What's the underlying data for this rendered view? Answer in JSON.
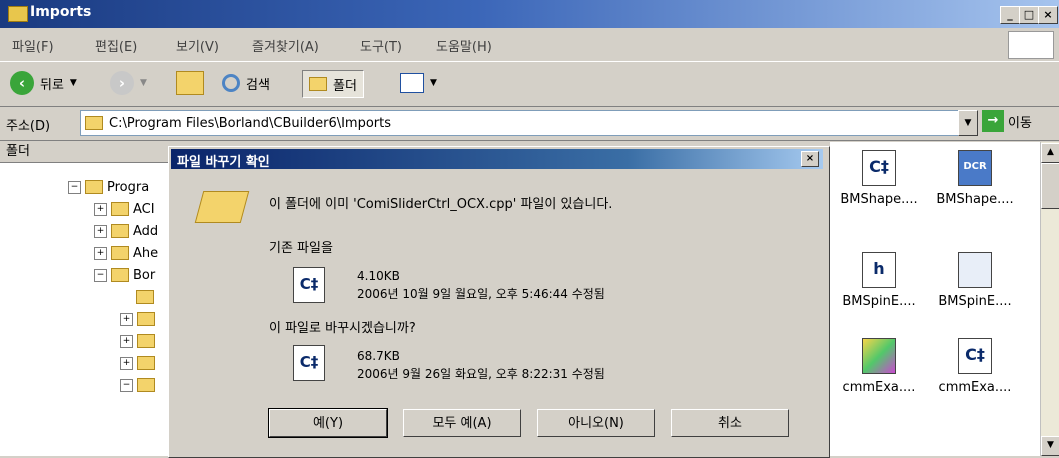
{
  "window": {
    "title": "Imports"
  },
  "menu": [
    "파일(F)",
    "편집(E)",
    "보기(V)",
    "즐겨찾기(A)",
    "도구(T)",
    "도움말(H)"
  ],
  "toolbar": {
    "back_label": "뒤로",
    "search_label": "검색",
    "folders_label": "폴더"
  },
  "address": {
    "label": "주소(D)",
    "value": "C:\\Program Files\\Borland\\CBuilder6\\Imports",
    "go_label": "이동"
  },
  "left_pane": {
    "header": "폴더",
    "tree": [
      {
        "label": "Progra"
      },
      {
        "label": "ACI"
      },
      {
        "label": "Add"
      },
      {
        "label": "Ahe"
      },
      {
        "label": "Bor"
      }
    ]
  },
  "files": [
    {
      "name": "BMShape....",
      "icon": "cpp-icon",
      "icon_text": "C‡"
    },
    {
      "name": "BMShape....",
      "icon": "dcr-icon",
      "icon_text": "DCR"
    },
    {
      "name": "BMSpinE....",
      "icon": "h-icon",
      "icon_text": "h"
    },
    {
      "name": "BMSpinE....",
      "icon": "window-icon",
      "icon_text": ""
    },
    {
      "name": "cmmExa....",
      "icon": "palette-icon",
      "icon_text": ""
    },
    {
      "name": "cmmExa....",
      "icon": "cpp-icon",
      "icon_text": "C‡"
    }
  ],
  "dialog": {
    "title": "파일 바꾸기 확인",
    "message": "이 폴더에 이미 'ComiSliderCtrl_OCX.cpp' 파일이 있습니다.",
    "existing_label": "기존 파일을",
    "existing_size": "4.10KB",
    "existing_date": "2006년 10월 9일 월요일, 오후 5:46:44 수정됨",
    "replace_label": "이 파일로 바꾸시겠습니까?",
    "new_size": "68.7KB",
    "new_date": "2006년 9월 26일 화요일, 오후 8:22:31 수정됨",
    "buttons": {
      "yes": "예(Y)",
      "yes_all": "모두 예(A)",
      "no": "아니오(N)",
      "cancel": "취소"
    }
  }
}
